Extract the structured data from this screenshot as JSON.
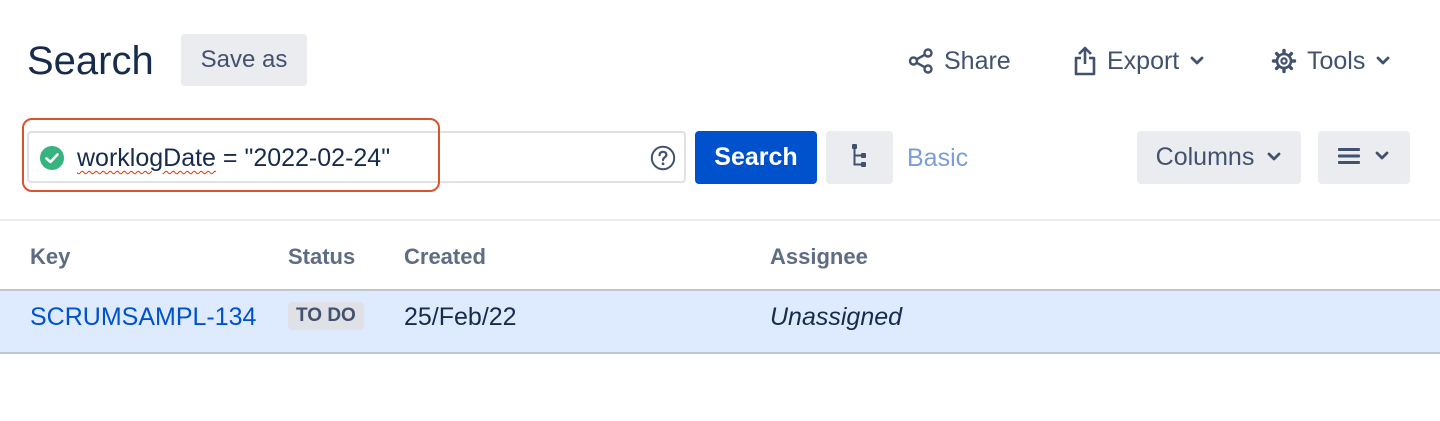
{
  "header": {
    "title": "Search",
    "save_as_label": "Save as",
    "share_label": "Share",
    "export_label": "Export",
    "tools_label": "Tools"
  },
  "search": {
    "jql_field": "worklogDate",
    "jql_rest": " = \"2022-02-24\"",
    "search_button_label": "Search",
    "basic_link_label": "Basic",
    "columns_label": "Columns"
  },
  "table": {
    "headers": [
      "Key",
      "Status",
      "Created",
      "Assignee"
    ],
    "rows": [
      {
        "key": "SCRUMSAMPL-134",
        "status": "TO DO",
        "created": "25/Feb/22",
        "assignee": "Unassigned"
      }
    ]
  },
  "colors": {
    "primary": "#0052cc",
    "row_selected": "#deebff",
    "valid_check": "#36b37e",
    "highlight_outline": "#d9532c"
  },
  "icons": {
    "valid": "check-circle-icon",
    "help": "question-circle-icon",
    "share": "share-icon",
    "export": "export-icon",
    "tools": "gear-icon",
    "tree": "tree-hierarchy-icon",
    "more": "menu-icon"
  }
}
